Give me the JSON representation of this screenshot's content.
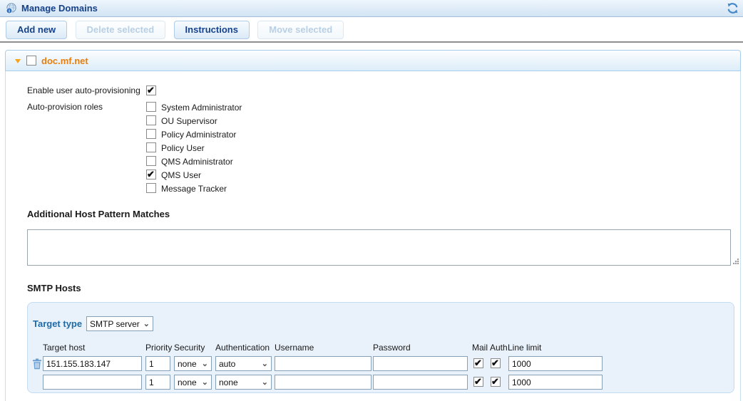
{
  "window": {
    "title": "Manage Domains"
  },
  "toolbar": {
    "add_new": "Add new",
    "delete_selected": "Delete selected",
    "instructions": "Instructions",
    "move_selected": "Move selected"
  },
  "domain": {
    "name": "doc.mf.net",
    "selected": false,
    "auto_provisioning": {
      "label": "Enable user auto-provisioning",
      "checked": true
    },
    "roles_label": "Auto-provision roles",
    "roles": [
      {
        "label": "System Administrator",
        "checked": false
      },
      {
        "label": "OU Supervisor",
        "checked": false
      },
      {
        "label": "Policy Administrator",
        "checked": false
      },
      {
        "label": "Policy User",
        "checked": false
      },
      {
        "label": "QMS Administrator",
        "checked": false
      },
      {
        "label": "QMS User",
        "checked": true
      },
      {
        "label": "Message Tracker",
        "checked": false
      }
    ],
    "host_patterns": {
      "heading": "Additional Host Pattern Matches",
      "value": ""
    },
    "smtp": {
      "heading": "SMTP Hosts",
      "target_type_label": "Target type",
      "target_type_value": "SMTP server",
      "headers": [
        "Target host",
        "Priority",
        "Security",
        "Authentication",
        "Username",
        "Password",
        "Mail",
        "Auth",
        "Line limit"
      ],
      "rows": [
        {
          "target_host": "151.155.183.147",
          "priority": "1",
          "security": "none",
          "authentication": "auto",
          "username": "",
          "password": "",
          "mail": true,
          "auth": true,
          "line_limit": "1000"
        },
        {
          "target_host": "",
          "priority": "1",
          "security": "none",
          "authentication": "none",
          "username": "",
          "password": "",
          "mail": true,
          "auth": true,
          "line_limit": "1000"
        }
      ]
    }
  },
  "icons": {
    "app": "globe-icon",
    "refresh": "refresh-icon",
    "collapse": "collapse-arrow-icon",
    "delete_row": "trash-icon"
  },
  "colors": {
    "title_blue": "#15428b",
    "domain_orange": "#e87e0e",
    "steel_blue": "#1e6ba8",
    "panel_bg": "#e9f2fb",
    "panel_border": "#c3dcef",
    "icon_blue": "#4387c7"
  }
}
